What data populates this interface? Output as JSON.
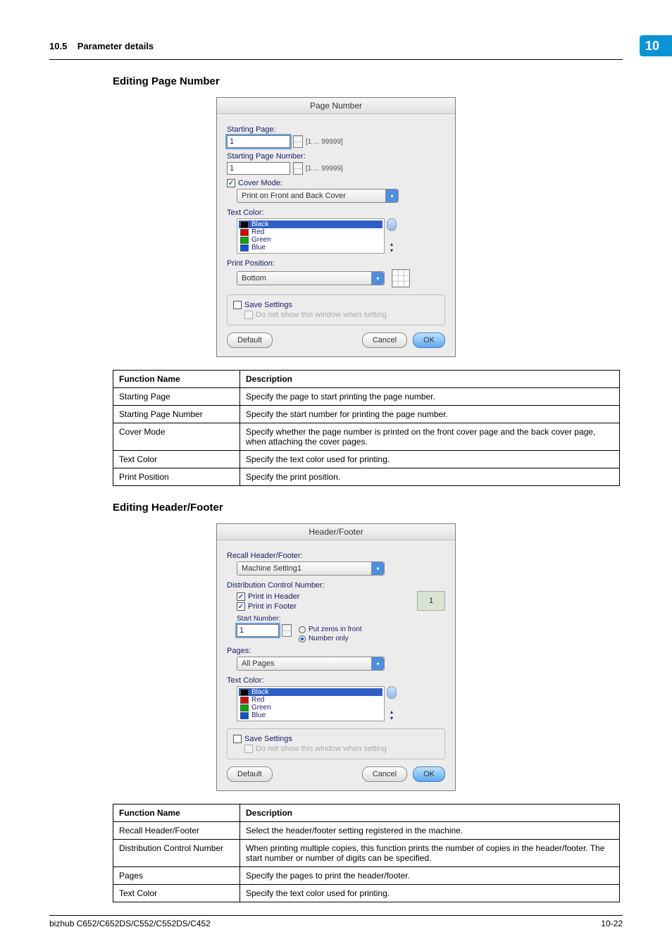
{
  "header": {
    "section_no": "10.5",
    "section_title": "Parameter details",
    "chapter_badge": "10"
  },
  "section1": {
    "title": "Editing Page Number",
    "dialog": {
      "title": "Page Number",
      "starting_page_label": "Starting Page:",
      "starting_page_value": "1",
      "range1": "[1 ... 99999]",
      "starting_page_number_label": "Starting Page Number:",
      "starting_page_number_value": "1",
      "range2": "[1 ... 99999]",
      "cover_mode_label": "Cover Mode:",
      "cover_mode_value": "Print on Front and Back Cover",
      "text_color_label": "Text Color:",
      "colors": [
        "Black",
        "Red",
        "Green",
        "Blue"
      ],
      "print_position_label": "Print Position:",
      "print_position_value": "Bottom",
      "save_settings": "Save Settings",
      "do_not_show": "Do not show this window when setting",
      "default_btn": "Default",
      "cancel_btn": "Cancel",
      "ok_btn": "OK"
    },
    "table": {
      "h1": "Function Name",
      "h2": "Description",
      "rows": [
        [
          "Starting Page",
          "Specify the page to start printing the page number."
        ],
        [
          "Starting Page Number",
          "Specify the start number for printing the page number."
        ],
        [
          "Cover Mode",
          "Specify whether the page number is printed on the front cover page and the back cover page, when attaching the cover pages."
        ],
        [
          "Text Color",
          "Specify the text color used for printing."
        ],
        [
          "Print Position",
          "Specify the print position."
        ]
      ]
    }
  },
  "section2": {
    "title": "Editing Header/Footer",
    "dialog": {
      "title": "Header/Footer",
      "recall_label": "Recall Header/Footer:",
      "recall_value": "Machine Setting1",
      "dcn_label": "Distribution Control Number:",
      "print_header": "Print in Header",
      "print_footer": "Print in Footer",
      "dcn_field": "1",
      "start_number_label": "Start Number:",
      "start_value": "1",
      "opt_zeros": "Put zeros in front",
      "opt_numonly": "Number only",
      "pages_label": "Pages:",
      "pages_value": "All Pages",
      "text_color_label": "Text Color:",
      "colors": [
        "Black",
        "Red",
        "Green",
        "Blue"
      ],
      "save_settings": "Save Settings",
      "do_not_show": "Do not show this window when setting",
      "default_btn": "Default",
      "cancel_btn": "Cancel",
      "ok_btn": "OK"
    },
    "table": {
      "h1": "Function Name",
      "h2": "Description",
      "rows": [
        [
          "Recall Header/Footer",
          "Select the header/footer setting registered in the machine."
        ],
        [
          "Distribution Control Number",
          "When printing multiple copies, this function prints the number of copies in the header/footer. The start number or number of digits can be specified."
        ],
        [
          "Pages",
          "Specify the pages to print the header/footer."
        ],
        [
          "Text Color",
          "Specify the text color used for printing."
        ]
      ]
    }
  },
  "footer": {
    "left": "bizhub C652/C652DS/C552/C552DS/C452",
    "right": "10-22"
  }
}
